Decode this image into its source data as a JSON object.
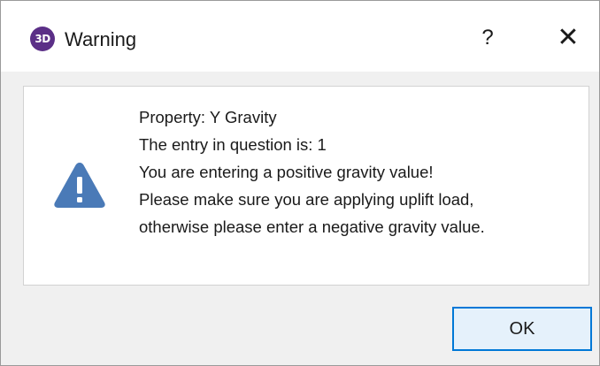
{
  "dialog": {
    "app_icon_text": "3D",
    "title": "Warning",
    "help_label": "?",
    "close_label": "✕"
  },
  "message": {
    "lines": [
      "Property: Y Gravity",
      "The entry in question is: 1",
      "You are entering a positive gravity value!",
      "Please make sure you are applying uplift load,",
      "otherwise please enter a negative gravity value."
    ]
  },
  "buttons": {
    "ok_label": "OK"
  },
  "colors": {
    "accent": "#0078d7",
    "warning_icon": "#4a7ab7",
    "app_icon": "#5b2f87"
  },
  "icons": {
    "app": "3d-app-icon",
    "warning": "warning-triangle-icon",
    "close": "close-icon",
    "help": "help-icon"
  }
}
